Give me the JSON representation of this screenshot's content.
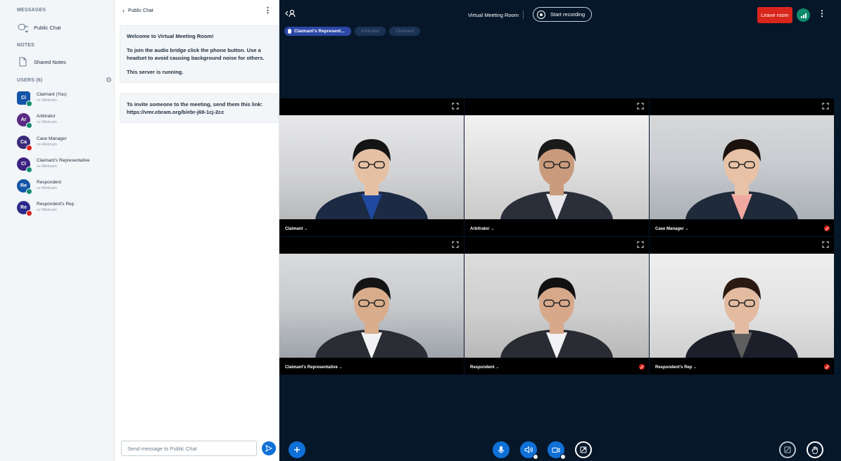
{
  "sidebar": {
    "messages_title": "MESSAGES",
    "public_chat_label": "Public Chat",
    "notes_title": "NOTES",
    "shared_notes_label": "Shared Notes",
    "users_title": "USERS (6)",
    "users": [
      {
        "initials": "Cl",
        "name": "Claimant (You)",
        "sub": "cv-Webcam",
        "color": "#1455a8",
        "status": "#0f8b6c",
        "square": true
      },
      {
        "initials": "Ar",
        "name": "Arbitrator",
        "sub": "cv-Webcam",
        "color": "#5b2c83",
        "status": "#0f8b6c",
        "square": false
      },
      {
        "initials": "Ca",
        "name": "Case Manager",
        "sub": "cv-Webcam",
        "color": "#3a2a7a",
        "status": "#d9261c",
        "square": false
      },
      {
        "initials": "Cl",
        "name": "Claimant's Representative",
        "sub": "cv-Webcam",
        "color": "#3b2280",
        "status": "#0f8b6c",
        "square": false
      },
      {
        "initials": "Re",
        "name": "Respondent",
        "sub": "cv-Webcam",
        "color": "#1455a8",
        "status": "#0f8b6c",
        "square": false
      },
      {
        "initials": "Re",
        "name": "Respondent's Rep",
        "sub": "cv-Webcam",
        "color": "#2a2a8a",
        "status": "#d9261c",
        "square": false
      }
    ]
  },
  "chat": {
    "header": "Public Chat",
    "welcome_prefix": "Welcome to ",
    "welcome_room": "Virtual Meeting Room",
    "welcome_suffix": "!",
    "audio_instructions": "To join the audio bridge click the phone button. Use a headset to avoid causing background noise for others.",
    "server_status": "This server is running.",
    "invite_text": "To invite someone to the meeting, send them this link:",
    "invite_link": "https://vmr.ebram.org/b/ebr-j69-1cj-2cc",
    "input_placeholder": "Send message to Public Chat"
  },
  "meeting": {
    "title": "Virtual Meeting Room",
    "record_label": "Start recording",
    "leave_label": "Leave room",
    "talkers": [
      {
        "name": "Claimant's Represent...",
        "state": "active"
      },
      {
        "name": "Arbitrator",
        "state": "muted"
      },
      {
        "name": "Claimant",
        "state": "muted"
      }
    ],
    "tiles": [
      {
        "name": "Claimant",
        "muted": false
      },
      {
        "name": "Arbitrator",
        "muted": false
      },
      {
        "name": "Case Manager",
        "muted": true
      },
      {
        "name": "Claimant's Representative",
        "muted": false
      },
      {
        "name": "Respondent",
        "muted": true
      },
      {
        "name": "Respondent's Rep",
        "muted": true
      }
    ]
  },
  "colors": {
    "accent": "#0f70d7",
    "leave": "#d9261c",
    "meeting_bg": "#06172a"
  }
}
